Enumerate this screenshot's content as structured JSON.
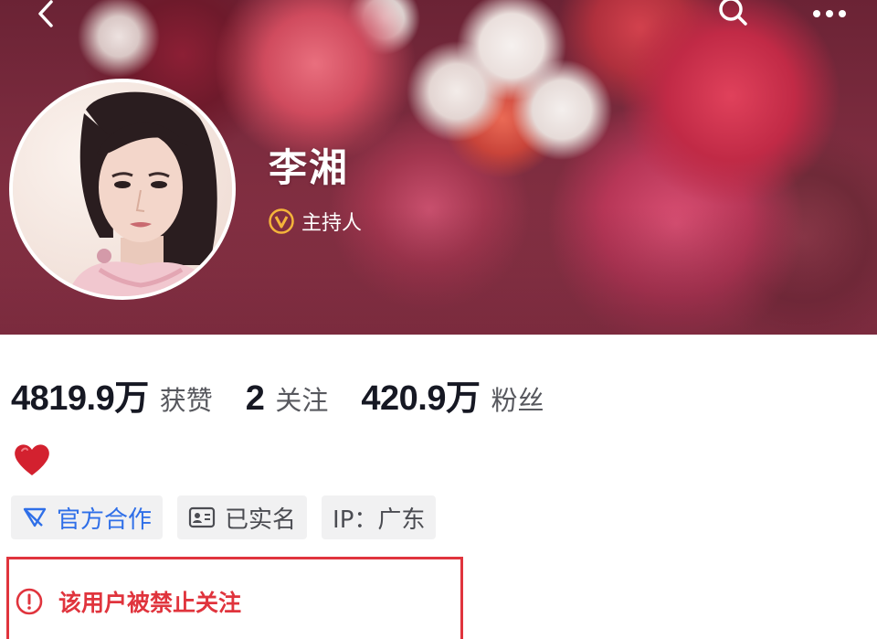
{
  "header": {
    "back_icon": "chevron-left-icon",
    "search_icon": "search-icon",
    "more_icon": "more-horizontal-icon"
  },
  "profile": {
    "name": "李湘",
    "verification_label": "主持人",
    "verification_icon": "verified-v-badge-icon"
  },
  "stats": [
    {
      "value": "4819.9万",
      "label": "获赞"
    },
    {
      "value": "2",
      "label": "关注"
    },
    {
      "value": "420.9万",
      "label": "粉丝"
    }
  ],
  "bio": {
    "icon": "red-heart-emoji"
  },
  "tags": [
    {
      "label": "官方合作",
      "icon": "official-cooperation-icon",
      "color": "#2f6fe8"
    },
    {
      "label": "已实名",
      "icon": "id-card-icon",
      "color": "#4b4c52"
    },
    {
      "label": "IP：广东",
      "color": "#4b4c52"
    }
  ],
  "notice": {
    "text": "该用户被禁止关注",
    "icon": "exclamation-circle-icon",
    "color": "#e0343d"
  }
}
